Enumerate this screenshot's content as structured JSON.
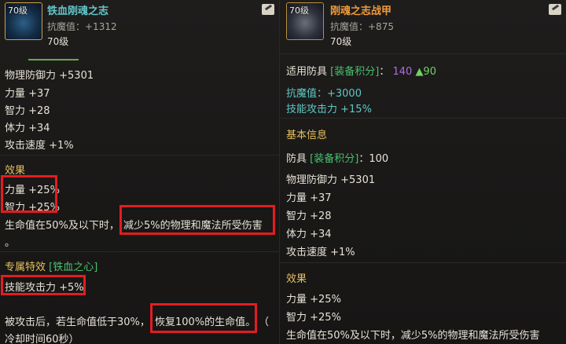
{
  "left": {
    "icon_level": "70级",
    "name": "铁血刚魂之志",
    "resist": "抗魔值：+1312",
    "level": "70级",
    "stats": [
      "物理防御力 +5301",
      "力量 +37",
      "智力 +28",
      "体力 +34",
      "攻击速度 +1%"
    ],
    "effect_title": "效果",
    "effects": [
      "力量 +25%",
      "智力 +25%"
    ],
    "effect_desc_a": "生命值在50%及以下时，",
    "effect_desc_b": "减少5%的物理和魔法所受伤害",
    "effect_desc_c": "。",
    "exclusive_title": "专属特效",
    "exclusive_name": "[铁血之心]",
    "exclusive_stat": "技能攻击力 +5%",
    "hit_a": "被攻击后，若生命值低于30%，",
    "hit_b": "恢复100%的生命值。",
    "hit_c": "（",
    "cooldown": "冷却时间60秒）"
  },
  "right": {
    "icon_level": "70级",
    "name": "刚魂之志战甲",
    "resist": "抗魔值：+875",
    "level": "70级",
    "applicable_label": "适用防具",
    "score_label": "[装备积分]",
    "score_colon": "：",
    "score_value": "140",
    "score_up": "▲90",
    "resist_value": "抗魔值：+3000",
    "skill_attack": "技能攻击力 +15%",
    "basic_info": "基本信息",
    "armor_label": "防具",
    "armor_score_label": "[装备积分]",
    "armor_score": "：100",
    "stats": [
      "物理防御力 +5301",
      "力量 +37",
      "智力 +28",
      "体力 +34",
      "攻击速度 +1%"
    ],
    "effect_title": "效果",
    "effects": [
      "力量 +25%",
      "智力 +25%"
    ],
    "effect_desc": "生命值在50%及以下时，减少5%的物理和魔法所受伤害"
  },
  "colors": {
    "highlight_box": "#e21d20",
    "left_name": "#63c4c9",
    "right_name": "#ef9a3c",
    "section": "#e7c05e",
    "bracket": "#49c06d",
    "score": "#b26ce0",
    "up_arrow": "#6fd35f"
  }
}
